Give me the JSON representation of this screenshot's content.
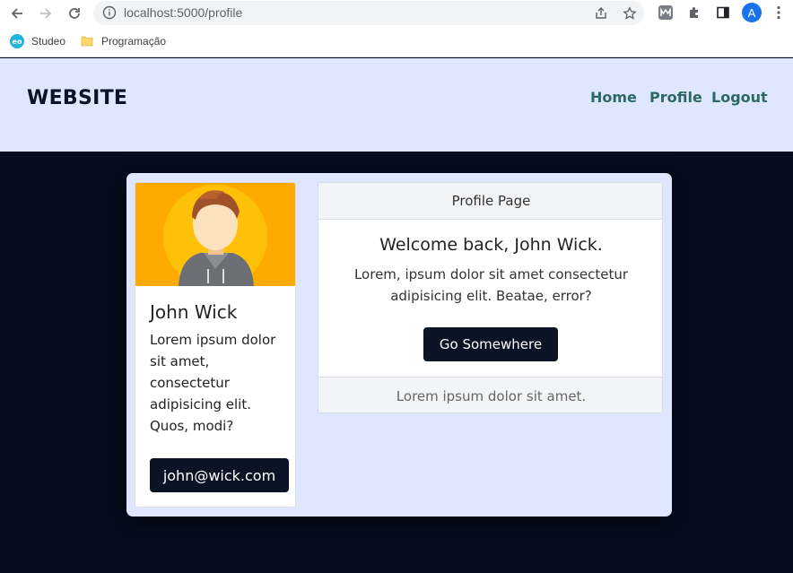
{
  "browser": {
    "url": "localhost:5000/profile",
    "avatar_letter": "A",
    "bookmarks": [
      {
        "label": "Studeo",
        "icon": "studeo-logo-icon"
      },
      {
        "label": "Programação",
        "icon": "folder-icon"
      }
    ]
  },
  "site": {
    "logo": "WEBSITE",
    "nav": [
      {
        "label": "Home"
      },
      {
        "label": "Profile"
      },
      {
        "label": "Logout"
      }
    ]
  },
  "profile": {
    "name": "John Wick",
    "bio": "Lorem ipsum dolor sit amet, consectetur adipisicing elit. Quos, modi?",
    "email": "john@wick.com"
  },
  "card": {
    "header": "Profile Page",
    "title": "Welcome back, John Wick.",
    "text": "Lorem, ipsum dolor sit amet consectetur adipisicing elit. Beatae, error?",
    "button": "Go Somewhere",
    "footer": "Lorem ipsum dolor sit amet."
  },
  "colors": {
    "header_bg": "#dfe6ff",
    "page_bg": "#050d1e",
    "nav_link": "#2c6a5f",
    "button_bg": "#0b1424",
    "avatar_bg": "#ffaa00"
  }
}
